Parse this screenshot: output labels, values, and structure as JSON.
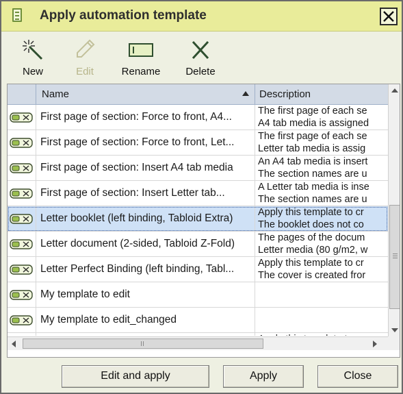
{
  "window": {
    "title": "Apply automation template"
  },
  "toolbar": {
    "new_label": "New",
    "edit_label": "Edit",
    "rename_label": "Rename",
    "delete_label": "Delete"
  },
  "table": {
    "columns": [
      "Name",
      "Description"
    ],
    "rows": [
      {
        "name": "First page of section: Force to front, A4...",
        "desc1": "The first page of each se",
        "desc2": "A4 tab media is assigned"
      },
      {
        "name": "First page of section: Force to front, Let...",
        "desc1": "The first page of each se",
        "desc2": "Letter tab media is assig"
      },
      {
        "name": "First page of section: Insert A4 tab media",
        "desc1": "An A4 tab media is insert",
        "desc2": "The section names are u"
      },
      {
        "name": "First page of section: Insert Letter tab...",
        "desc1": "A Letter tab media is inse",
        "desc2": "The section names are u"
      },
      {
        "name": "Letter booklet (left binding, Tabloid Extra)",
        "desc1": "Apply this template to cr",
        "desc2": "The booklet does not co"
      },
      {
        "name": "Letter document (2-sided, Tabloid Z-Fold)",
        "desc1": "The pages of the docum",
        "desc2": "Letter media (80 g/m2, w"
      },
      {
        "name": "Letter Perfect Binding (left binding, Tabl...",
        "desc1": "Apply this template to cr",
        "desc2": "The cover is created fror"
      },
      {
        "name": "My template to edit",
        "desc1": "",
        "desc2": ""
      },
      {
        "name": "My template to edit_changed",
        "desc1": "",
        "desc2": ""
      },
      {
        "name": "",
        "desc1": "Apply this template to cr",
        "desc2": ""
      }
    ],
    "selected_index": 4
  },
  "buttons": {
    "edit_and_apply": "Edit and apply",
    "apply": "Apply",
    "close": "Close"
  }
}
